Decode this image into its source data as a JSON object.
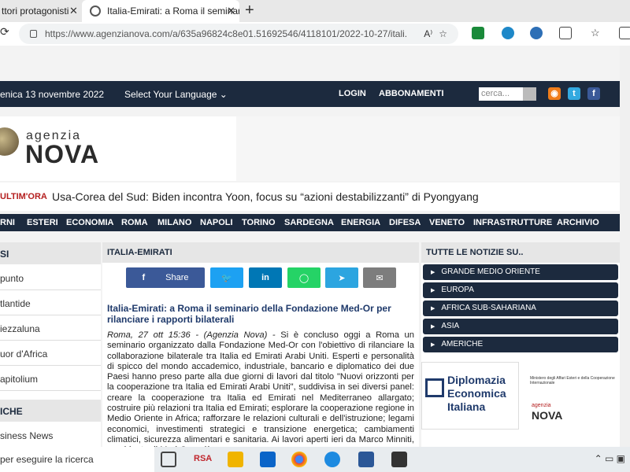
{
  "browser": {
    "tab_inactive": "ttori protagonisti",
    "tab_active": "Italia-Emirati: a Roma il seminario",
    "url": "https://www.agenzianova.com/a/635a96824c8e01.51692546/4118101/2022-10-27/itali..."
  },
  "topbar": {
    "date": "enica 13 novembre 2022",
    "language": "Select Your Language",
    "login": "LOGIN",
    "abbonamenti": "ABBONAMENTI",
    "search_placeholder": "cerca..."
  },
  "logo": {
    "small": "agenzia",
    "big": "NOVA"
  },
  "breaking": {
    "label": "ULTIM'ORA",
    "text": "Usa-Corea del Sud: Biden incontra Yoon, focus su “azioni destabilizzanti” di Pyongyang"
  },
  "menu": [
    "RNI",
    "ESTERI",
    "ECONOMIA",
    "ROMA",
    "MILANO",
    "NAPOLI",
    "TORINO",
    "SARDEGNA",
    "ENERGIA",
    "DIFESA",
    "VENETO",
    "INFRASTRUTTURE",
    "ARCHIVIO"
  ],
  "sidebar_left": {
    "heading": "SI",
    "items": [
      "punto",
      "tlantide",
      "iezzaluna",
      "uor d'Africa",
      "apitolium"
    ],
    "heading2": "ICHE",
    "items2": [
      "siness News"
    ]
  },
  "article": {
    "section": "ITALIA-EMIRATI",
    "share": {
      "facebook": "Share"
    },
    "title": "Italia-Emirati: a Roma il seminario della Fondazione Med-Or per rilanciare i rapporti bilaterali",
    "lead": "Roma, 27 ott 15:36 - (Agenzia Nova) -",
    "body": "Si è concluso oggi a Roma un seminario organizzato dalla Fondazione Med-Or con l'obiettivo di rilanciare la collaborazione bilaterale tra Italia ed Emirati Arabi Uniti. Esperti e personalità di spicco del mondo accademico, industriale, bancario e diplomatico dei due Paesi hanno preso parte alla due giorni di lavori dal titolo \"Nuovi orizzonti per la cooperazione tra Italia ed Emirati Arabi Uniti\", suddivisa in sei diversi panel: creare la cooperazione tra Italia ed Emirati nel Mediterraneo allargato; costruire più relazioni tra Italia ed Emirati; esplorare la cooperazione regione in Medio Oriente in Africa; rafforzare le relazioni culturali e dell'istruzione; legami economici, investimenti strategici e transizione energetica; cambiamenti climatici, sicurezza alimentari e sanitaria. Ai lavori aperti ieri da Marco Minniti, presidente di Med-Or e già"
  },
  "sidebar_right": {
    "heading": "TUTTE LE NOTIZIE SU..",
    "items": [
      "GRANDE MEDIO ORIENTE",
      "EUROPA",
      "AFRICA SUB-SAHARIANA",
      "ASIA",
      "AMERICHE"
    ],
    "banner_lines": [
      "Diplomazia",
      "Economica",
      "Italiana"
    ],
    "ministry": "Ministero degli Affari Esteri e della Cooperazione Internazionale",
    "banner_nova_small": "agenzia",
    "banner_nova": "NOVA"
  },
  "taskbar": {
    "search": "per eseguire la ricerca",
    "rsa": "RSA"
  },
  "colors": {
    "navy": "#1c2a3e",
    "facebook": "#3b5998",
    "twitter": "#1da1f2",
    "linkedin": "#0077b5",
    "whatsapp": "#25d366",
    "telegram": "#2ca5e0",
    "mail": "#7d7d7d"
  }
}
